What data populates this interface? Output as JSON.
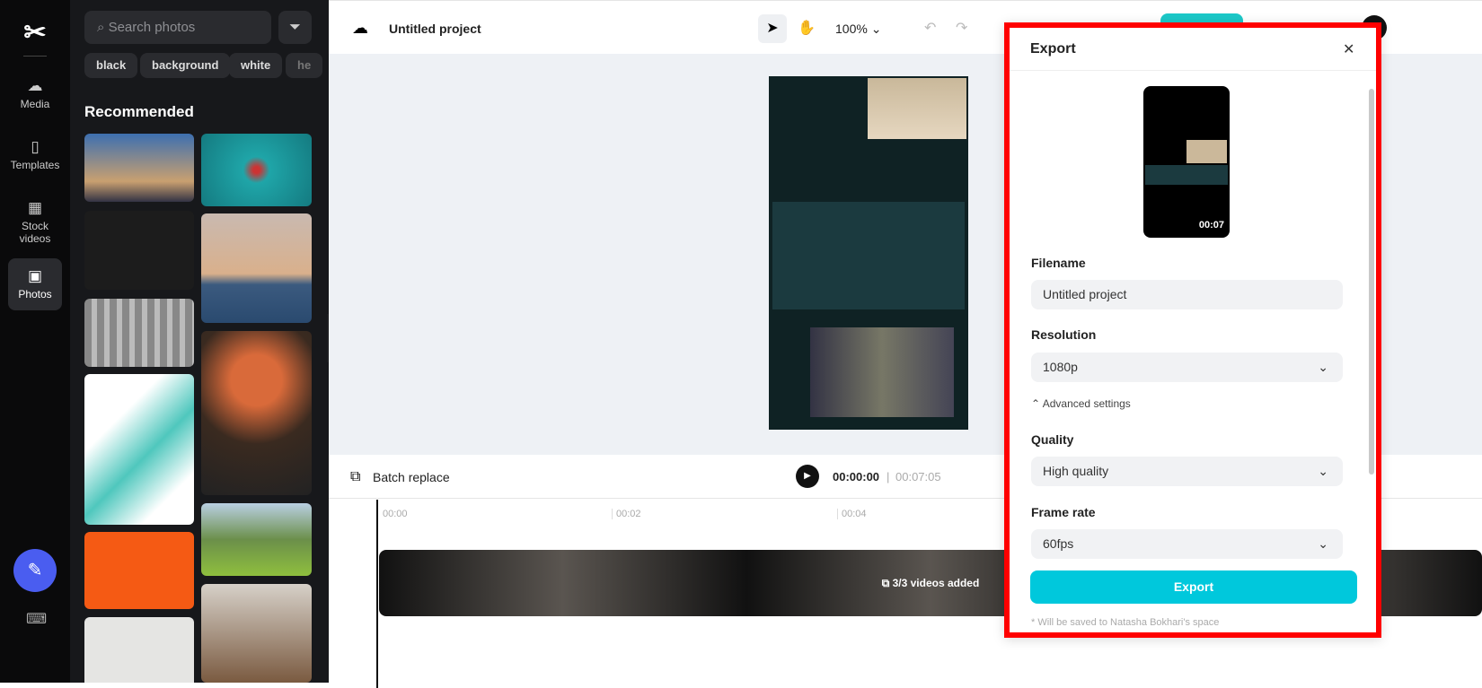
{
  "rail": {
    "items": [
      {
        "label": "Media",
        "icon": "cloud-upload-icon"
      },
      {
        "label": "Templates",
        "icon": "templates-icon"
      },
      {
        "label": "Stock videos",
        "icon": "film-icon"
      },
      {
        "label": "Photos",
        "icon": "image-icon"
      }
    ]
  },
  "photos": {
    "search_placeholder": "Search photos",
    "chips": [
      "black",
      "background",
      "white",
      "he"
    ],
    "section_title": "Recommended"
  },
  "header": {
    "project_title": "Untitled project",
    "zoom": "100%"
  },
  "timeline": {
    "batch_replace": "Batch replace",
    "current_time": "00:00:00",
    "total_time": "00:07:05",
    "ticks": [
      "00:00",
      "00:02",
      "00:04"
    ],
    "clip_label": "3/3 videos added"
  },
  "export": {
    "title": "Export",
    "duration": "00:07",
    "filename_label": "Filename",
    "filename_value": "Untitled project",
    "resolution_label": "Resolution",
    "resolution_value": "1080p",
    "advanced_label": "Advanced settings",
    "quality_label": "Quality",
    "quality_value": "High quality",
    "framerate_label": "Frame rate",
    "framerate_value": "60fps",
    "export_button": "Export",
    "note": "* Will be saved to Natasha Bokhari's space",
    "accent": "#00c8dc"
  }
}
